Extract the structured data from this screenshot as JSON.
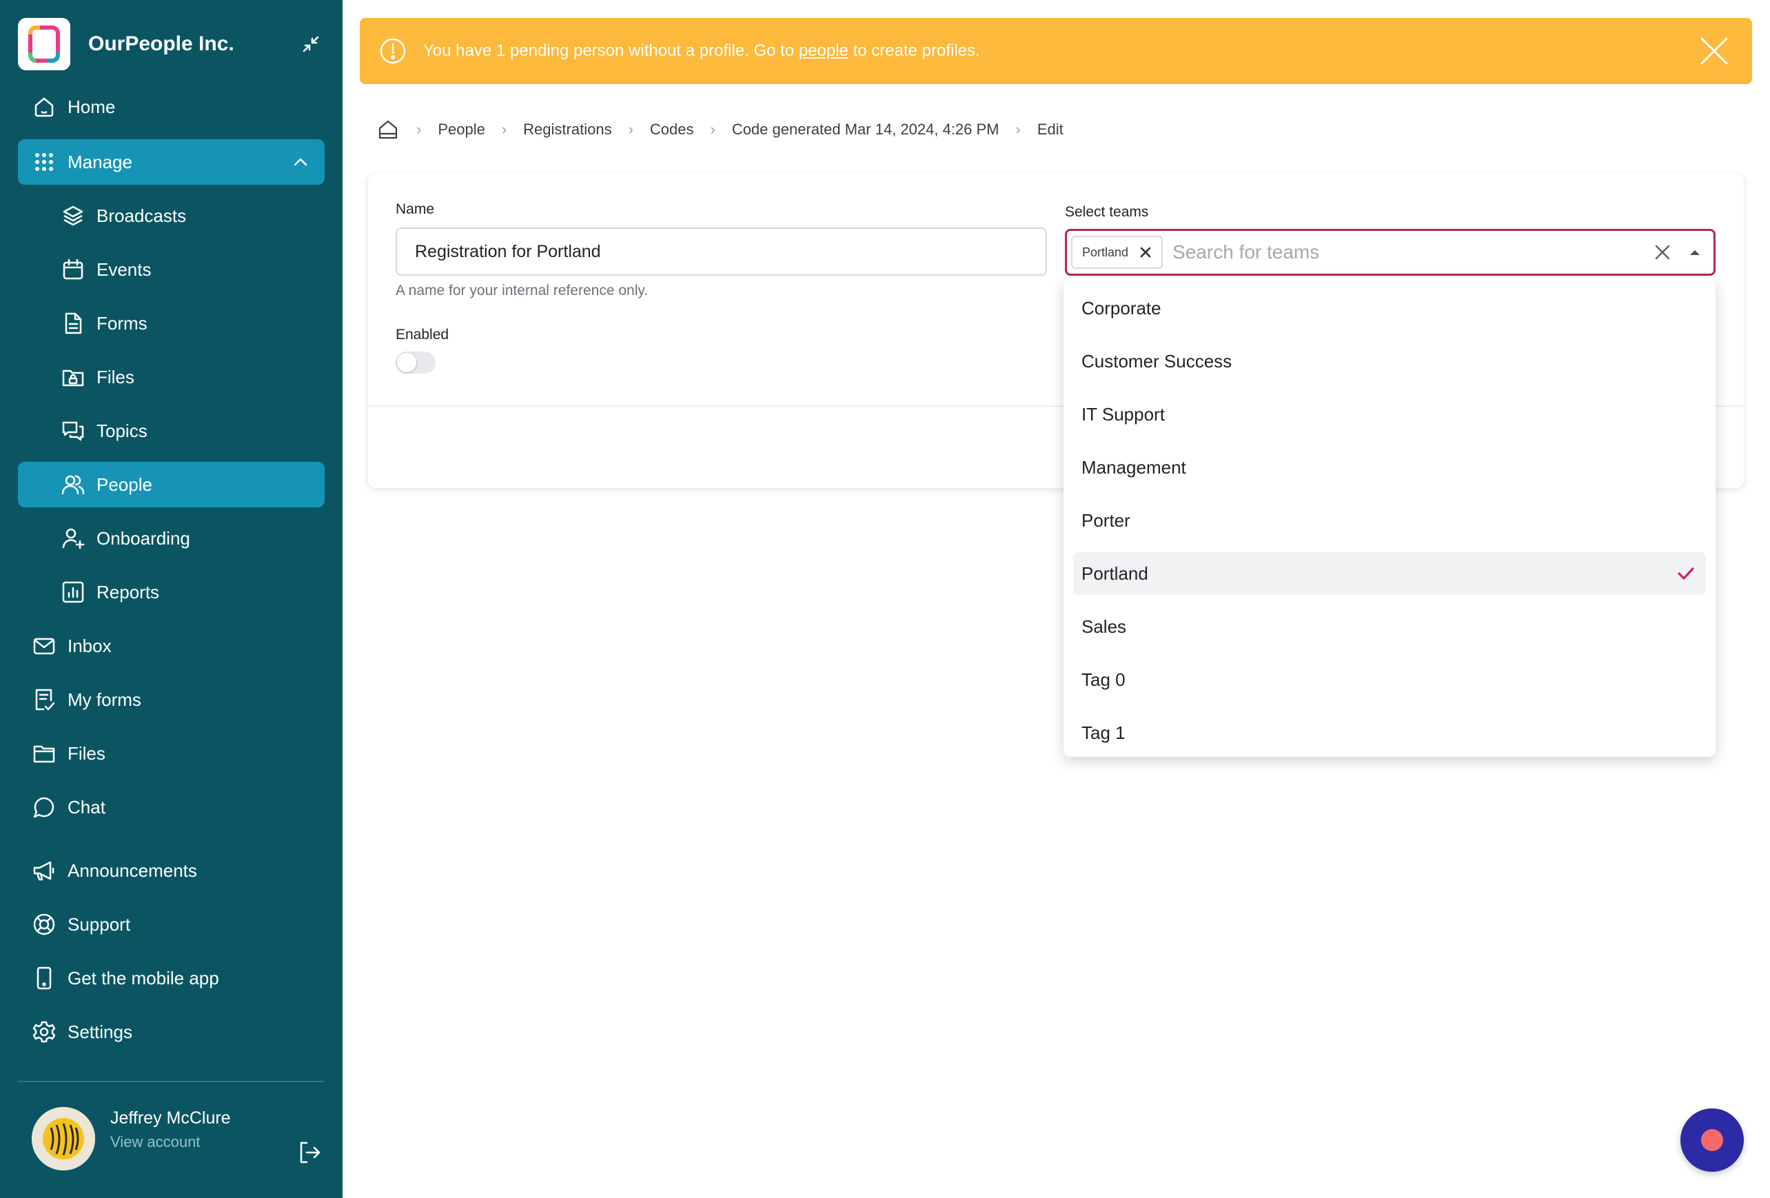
{
  "org": {
    "name": "OurPeople Inc."
  },
  "sidebar": {
    "items": [
      {
        "label": "Home",
        "icon": "home-icon"
      },
      {
        "label": "Manage",
        "icon": "grid-icon"
      },
      {
        "label": "Broadcasts",
        "icon": "layers-icon"
      },
      {
        "label": "Events",
        "icon": "calendar-icon"
      },
      {
        "label": "Forms",
        "icon": "document-icon"
      },
      {
        "label": "Files",
        "icon": "folder-lock-icon"
      },
      {
        "label": "Topics",
        "icon": "chat-bubbles-icon"
      },
      {
        "label": "People",
        "icon": "users-icon"
      },
      {
        "label": "Onboarding",
        "icon": "user-plus-icon"
      },
      {
        "label": "Reports",
        "icon": "bar-chart-icon"
      },
      {
        "label": "Inbox",
        "icon": "mail-icon"
      },
      {
        "label": "My forms",
        "icon": "form-check-icon"
      },
      {
        "label": "Files",
        "icon": "folder-icon"
      },
      {
        "label": "Chat",
        "icon": "chat-icon"
      },
      {
        "label": "Announcements",
        "icon": "megaphone-icon"
      },
      {
        "label": "Support",
        "icon": "lifebuoy-icon"
      },
      {
        "label": "Get the mobile app",
        "icon": "phone-icon"
      },
      {
        "label": "Settings",
        "icon": "gear-icon"
      }
    ]
  },
  "user": {
    "name": "Jeffrey McClure",
    "sub": "View account"
  },
  "banner": {
    "text_before": "You have 1 pending person without a profile. Go to ",
    "link": "people",
    "text_after": " to create profiles."
  },
  "breadcrumb": [
    "People",
    "Registrations",
    "Codes",
    "Code generated Mar 14, 2024, 4:26 PM",
    "Edit"
  ],
  "form": {
    "name_label": "Name",
    "name_value": "Registration for Portland",
    "name_help": "A name for your internal reference only.",
    "enabled_label": "Enabled",
    "teams_label": "Select teams",
    "teams_placeholder": "Search for teams",
    "selected_chip": "Portland"
  },
  "dropdown": {
    "options": [
      "Corporate",
      "Customer Success",
      "IT Support",
      "Management",
      "Porter",
      "Portland",
      "Sales",
      "Tag 0",
      "Tag 1"
    ],
    "selected": "Portland"
  },
  "colors": {
    "sidebar": "#0b5563",
    "active": "#1694b5",
    "banner": "#fdb93c",
    "accent": "#b3265f",
    "fab": "#2d2aa5"
  }
}
